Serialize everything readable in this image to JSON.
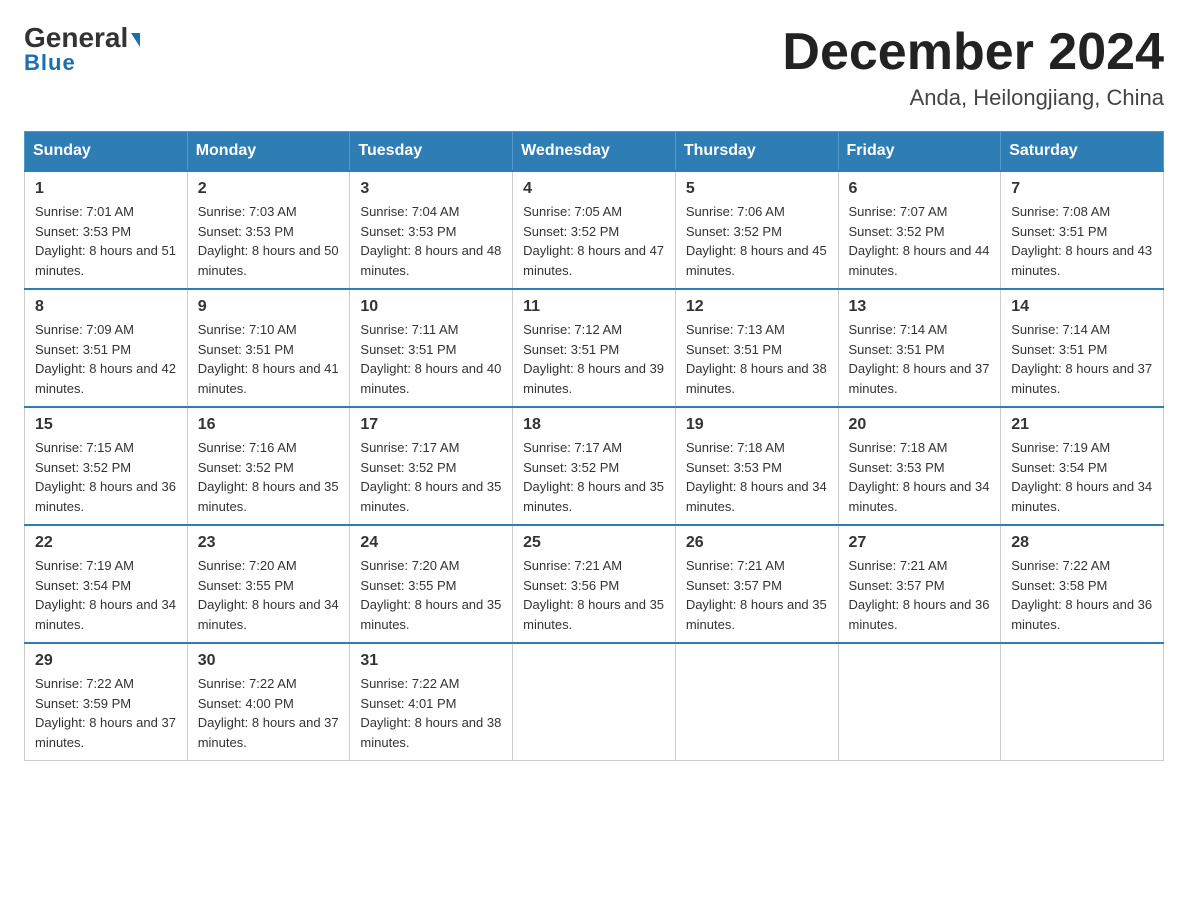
{
  "header": {
    "logo_general": "General",
    "logo_blue": "Blue",
    "month_title": "December 2024",
    "subtitle": "Anda, Heilongjiang, China"
  },
  "days_of_week": [
    "Sunday",
    "Monday",
    "Tuesday",
    "Wednesday",
    "Thursday",
    "Friday",
    "Saturday"
  ],
  "weeks": [
    [
      {
        "day": "1",
        "sunrise": "7:01 AM",
        "sunset": "3:53 PM",
        "daylight": "8 hours and 51 minutes."
      },
      {
        "day": "2",
        "sunrise": "7:03 AM",
        "sunset": "3:53 PM",
        "daylight": "8 hours and 50 minutes."
      },
      {
        "day": "3",
        "sunrise": "7:04 AM",
        "sunset": "3:53 PM",
        "daylight": "8 hours and 48 minutes."
      },
      {
        "day": "4",
        "sunrise": "7:05 AM",
        "sunset": "3:52 PM",
        "daylight": "8 hours and 47 minutes."
      },
      {
        "day": "5",
        "sunrise": "7:06 AM",
        "sunset": "3:52 PM",
        "daylight": "8 hours and 45 minutes."
      },
      {
        "day": "6",
        "sunrise": "7:07 AM",
        "sunset": "3:52 PM",
        "daylight": "8 hours and 44 minutes."
      },
      {
        "day": "7",
        "sunrise": "7:08 AM",
        "sunset": "3:51 PM",
        "daylight": "8 hours and 43 minutes."
      }
    ],
    [
      {
        "day": "8",
        "sunrise": "7:09 AM",
        "sunset": "3:51 PM",
        "daylight": "8 hours and 42 minutes."
      },
      {
        "day": "9",
        "sunrise": "7:10 AM",
        "sunset": "3:51 PM",
        "daylight": "8 hours and 41 minutes."
      },
      {
        "day": "10",
        "sunrise": "7:11 AM",
        "sunset": "3:51 PM",
        "daylight": "8 hours and 40 minutes."
      },
      {
        "day": "11",
        "sunrise": "7:12 AM",
        "sunset": "3:51 PM",
        "daylight": "8 hours and 39 minutes."
      },
      {
        "day": "12",
        "sunrise": "7:13 AM",
        "sunset": "3:51 PM",
        "daylight": "8 hours and 38 minutes."
      },
      {
        "day": "13",
        "sunrise": "7:14 AM",
        "sunset": "3:51 PM",
        "daylight": "8 hours and 37 minutes."
      },
      {
        "day": "14",
        "sunrise": "7:14 AM",
        "sunset": "3:51 PM",
        "daylight": "8 hours and 37 minutes."
      }
    ],
    [
      {
        "day": "15",
        "sunrise": "7:15 AM",
        "sunset": "3:52 PM",
        "daylight": "8 hours and 36 minutes."
      },
      {
        "day": "16",
        "sunrise": "7:16 AM",
        "sunset": "3:52 PM",
        "daylight": "8 hours and 35 minutes."
      },
      {
        "day": "17",
        "sunrise": "7:17 AM",
        "sunset": "3:52 PM",
        "daylight": "8 hours and 35 minutes."
      },
      {
        "day": "18",
        "sunrise": "7:17 AM",
        "sunset": "3:52 PM",
        "daylight": "8 hours and 35 minutes."
      },
      {
        "day": "19",
        "sunrise": "7:18 AM",
        "sunset": "3:53 PM",
        "daylight": "8 hours and 34 minutes."
      },
      {
        "day": "20",
        "sunrise": "7:18 AM",
        "sunset": "3:53 PM",
        "daylight": "8 hours and 34 minutes."
      },
      {
        "day": "21",
        "sunrise": "7:19 AM",
        "sunset": "3:54 PM",
        "daylight": "8 hours and 34 minutes."
      }
    ],
    [
      {
        "day": "22",
        "sunrise": "7:19 AM",
        "sunset": "3:54 PM",
        "daylight": "8 hours and 34 minutes."
      },
      {
        "day": "23",
        "sunrise": "7:20 AM",
        "sunset": "3:55 PM",
        "daylight": "8 hours and 34 minutes."
      },
      {
        "day": "24",
        "sunrise": "7:20 AM",
        "sunset": "3:55 PM",
        "daylight": "8 hours and 35 minutes."
      },
      {
        "day": "25",
        "sunrise": "7:21 AM",
        "sunset": "3:56 PM",
        "daylight": "8 hours and 35 minutes."
      },
      {
        "day": "26",
        "sunrise": "7:21 AM",
        "sunset": "3:57 PM",
        "daylight": "8 hours and 35 minutes."
      },
      {
        "day": "27",
        "sunrise": "7:21 AM",
        "sunset": "3:57 PM",
        "daylight": "8 hours and 36 minutes."
      },
      {
        "day": "28",
        "sunrise": "7:22 AM",
        "sunset": "3:58 PM",
        "daylight": "8 hours and 36 minutes."
      }
    ],
    [
      {
        "day": "29",
        "sunrise": "7:22 AM",
        "sunset": "3:59 PM",
        "daylight": "8 hours and 37 minutes."
      },
      {
        "day": "30",
        "sunrise": "7:22 AM",
        "sunset": "4:00 PM",
        "daylight": "8 hours and 37 minutes."
      },
      {
        "day": "31",
        "sunrise": "7:22 AM",
        "sunset": "4:01 PM",
        "daylight": "8 hours and 38 minutes."
      },
      null,
      null,
      null,
      null
    ]
  ]
}
